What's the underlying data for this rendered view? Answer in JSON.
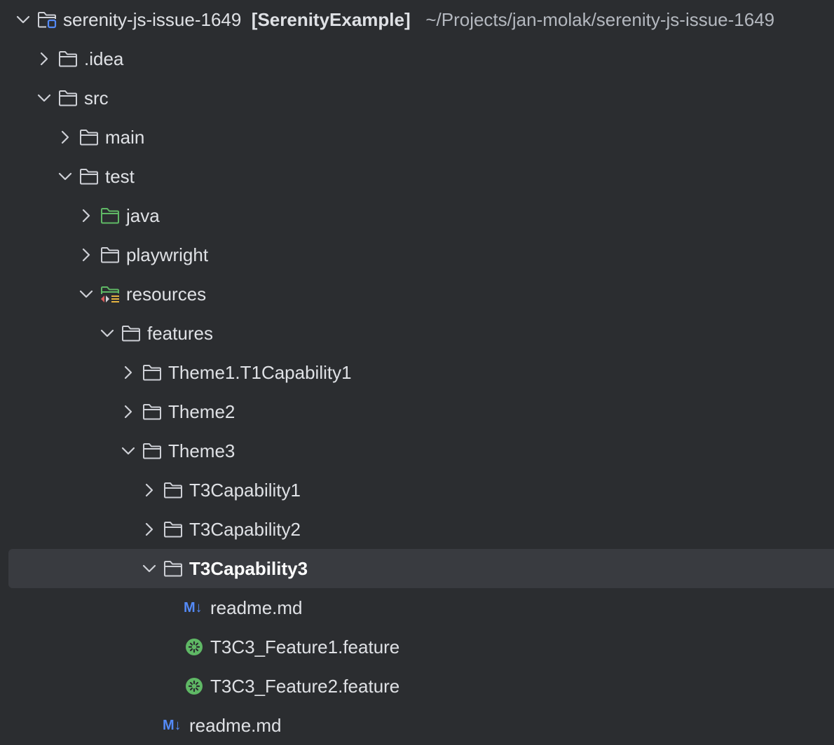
{
  "project": {
    "name": "serenity-js-issue-1649",
    "module": "[SerenityExample]",
    "path": "~/Projects/jan-molak/serenity-js-issue-1649"
  },
  "tree": {
    "idea": ".idea",
    "src": "src",
    "main": "main",
    "test": "test",
    "java": "java",
    "playwright": "playwright",
    "resources": "resources",
    "features": "features",
    "theme1": "Theme1.T1Capability1",
    "theme2": "Theme2",
    "theme3": "Theme3",
    "t3c1": "T3Capability1",
    "t3c2": "T3Capability2",
    "t3c3": "T3Capability3",
    "readme_inner": "readme.md",
    "feature1": "T3C3_Feature1.feature",
    "feature2": "T3C3_Feature2.feature",
    "readme_outer": "readme.md"
  },
  "icons": {
    "markdown_glyph": "M↓",
    "chevron_expanded": "chevron-down-icon",
    "chevron_collapsed": "chevron-right-icon",
    "folder": "folder-icon",
    "source_folder": "source-folder-icon",
    "resources_folder": "resources-folder-icon",
    "module": "module-icon",
    "cucumber": "cucumber-icon",
    "markdown": "markdown-icon"
  },
  "colors": {
    "background": "#2b2d30",
    "selection": "#393b40",
    "text": "#dfe1e5",
    "folder_stroke": "#ced0d6",
    "source_folder": "#5fb865",
    "markdown": "#548af7",
    "cucumber": "#5fb865"
  }
}
